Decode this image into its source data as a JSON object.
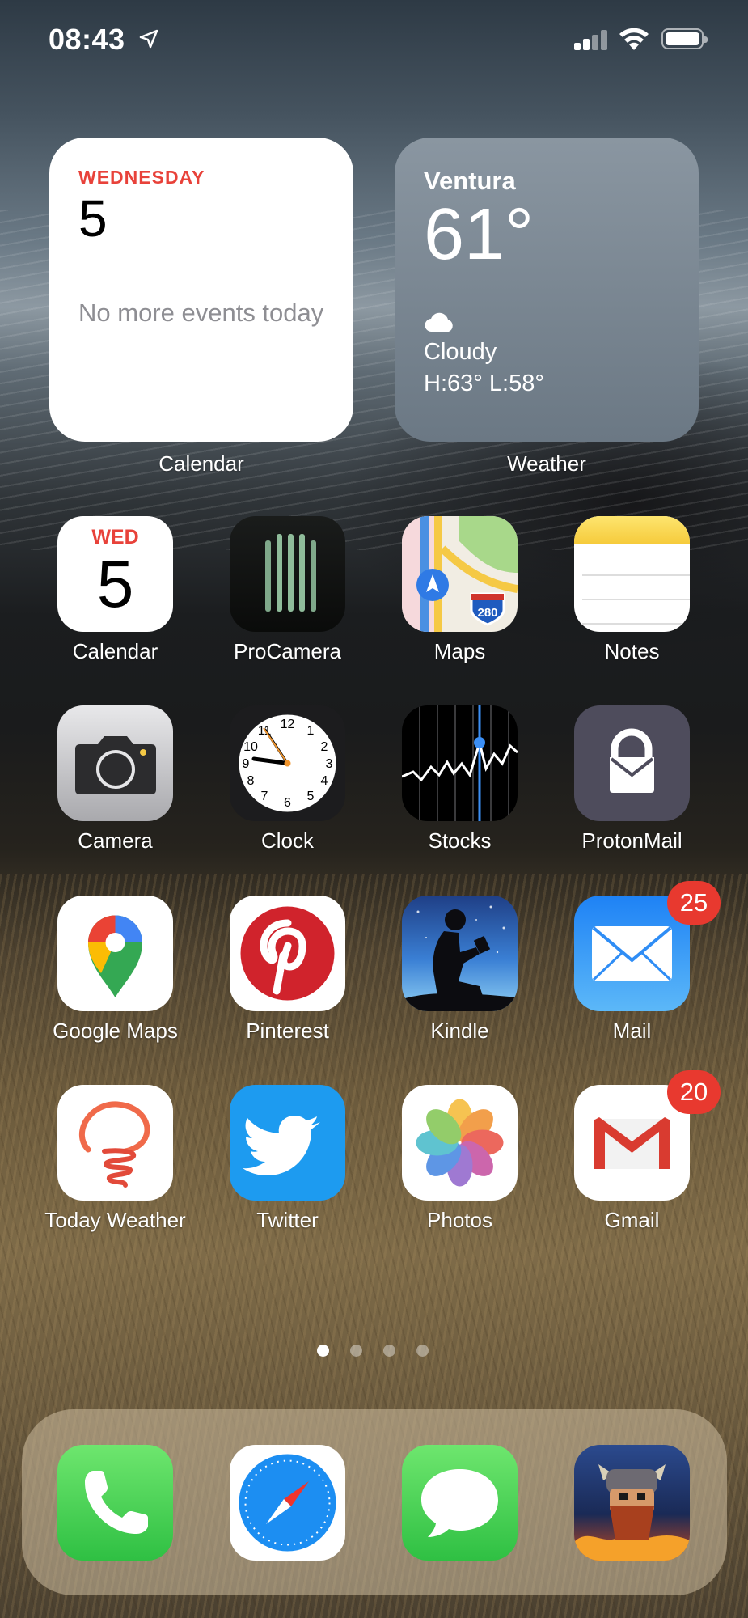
{
  "status_bar": {
    "time": "08:43"
  },
  "widgets": {
    "calendar": {
      "day": "WEDNESDAY",
      "date": "5",
      "message": "No more events today",
      "label": "Calendar"
    },
    "weather": {
      "city": "Ventura",
      "temp": "61°",
      "condition": "Cloudy",
      "high_low": "H:63° L:58°",
      "label": "Weather"
    }
  },
  "apps": {
    "calendar": {
      "label": "Calendar",
      "day": "WED",
      "date": "5"
    },
    "procamera": {
      "label": "ProCamera"
    },
    "maps": {
      "label": "Maps",
      "shield": "280"
    },
    "notes": {
      "label": "Notes"
    },
    "camera": {
      "label": "Camera"
    },
    "clock": {
      "label": "Clock"
    },
    "stocks": {
      "label": "Stocks"
    },
    "protonmail": {
      "label": "ProtonMail"
    },
    "google_maps": {
      "label": "Google Maps"
    },
    "pinterest": {
      "label": "Pinterest"
    },
    "kindle": {
      "label": "Kindle"
    },
    "mail": {
      "label": "Mail",
      "badge": "25"
    },
    "today_weather": {
      "label": "Today Weather"
    },
    "twitter": {
      "label": "Twitter"
    },
    "photos": {
      "label": "Photos"
    },
    "gmail": {
      "label": "Gmail",
      "badge": "20"
    }
  },
  "page_indicator": {
    "pages": 4,
    "current": 1
  },
  "dock": [
    "phone",
    "safari",
    "messages",
    "game"
  ],
  "icons": {
    "status": [
      "location-arrow-icon",
      "cellular-signal-icon",
      "wifi-icon",
      "battery-icon"
    ],
    "weather_condition": "cloud-icon"
  },
  "colors": {
    "badge_red": "#e8392f",
    "calendar_red": "#e8423a"
  }
}
